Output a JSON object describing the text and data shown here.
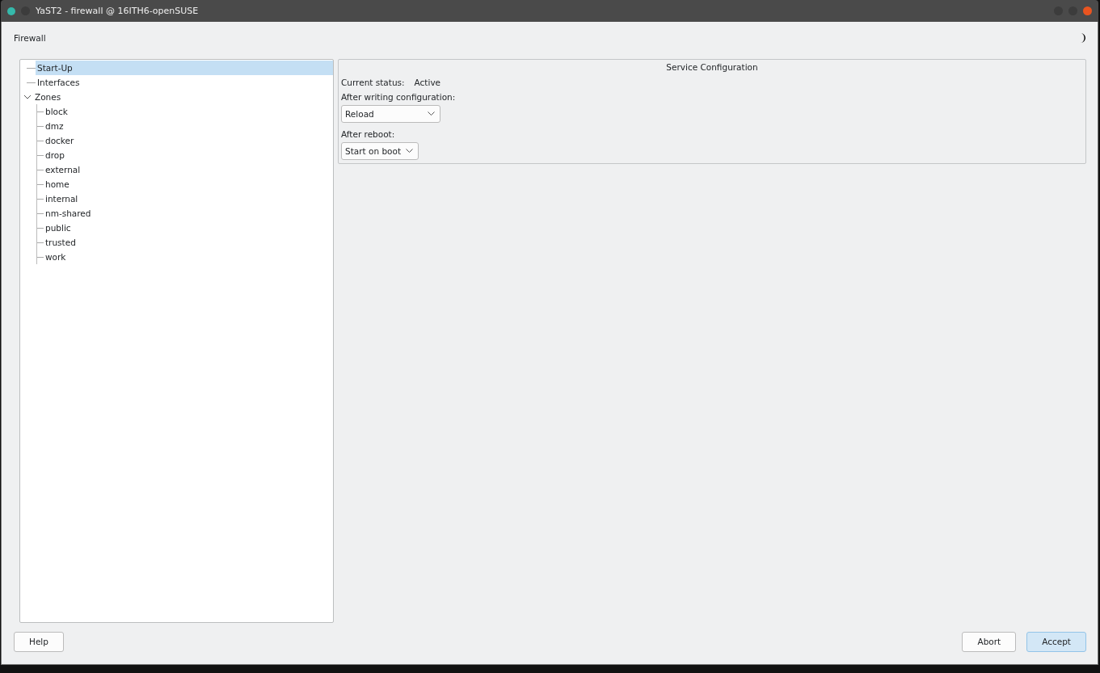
{
  "window": {
    "title": "YaST2 - firewall @ 16ITH6-openSUSE"
  },
  "heading": "Firewall",
  "tree": [
    {
      "label": "Start-Up",
      "selected": true
    },
    {
      "label": "Interfaces",
      "selected": false
    },
    {
      "label": "Zones",
      "selected": false,
      "expanded": true,
      "children": [
        {
          "label": "block",
          "selected": false
        },
        {
          "label": "dmz",
          "selected": false
        },
        {
          "label": "docker",
          "selected": false
        },
        {
          "label": "drop",
          "selected": false
        },
        {
          "label": "external",
          "selected": false
        },
        {
          "label": "home",
          "selected": false
        },
        {
          "label": "internal",
          "selected": false
        },
        {
          "label": "nm-shared",
          "selected": false
        },
        {
          "label": "public",
          "selected": false
        },
        {
          "label": "trusted",
          "selected": false
        },
        {
          "label": "work",
          "selected": false
        }
      ]
    }
  ],
  "service": {
    "title": "Service Configuration",
    "status_label": "Current status:",
    "status_value": "Active",
    "after_writing": {
      "label": "After writing configuration:",
      "value": "Reload"
    },
    "after_reboot": {
      "label": "After reboot:",
      "value": "Start on boot"
    }
  },
  "buttons": {
    "help": "Help",
    "abort": "Abort",
    "accept": "Accept"
  }
}
